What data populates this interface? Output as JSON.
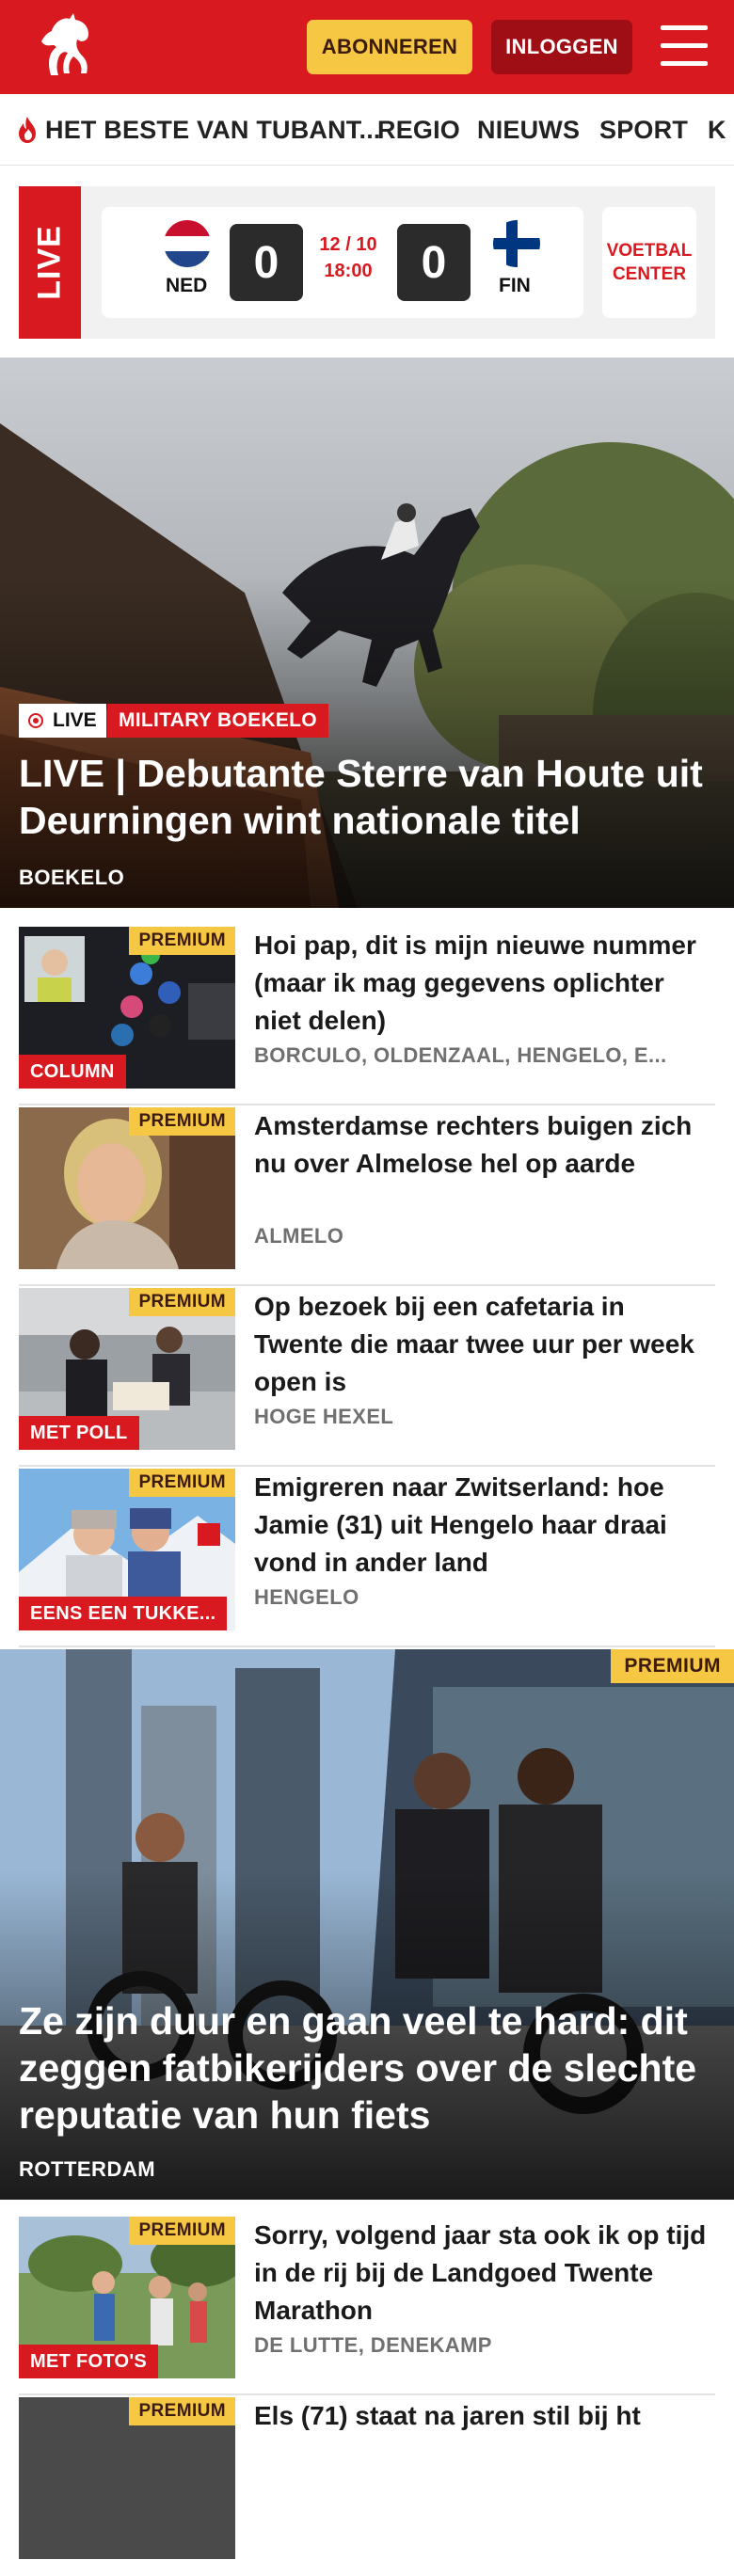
{
  "header": {
    "subscribe_label": "ABONNEREN",
    "login_label": "INLOGGEN",
    "brand_color": "#d81a20"
  },
  "nav": {
    "items": [
      {
        "label": "HET BESTE VAN TUBANT...",
        "icon": "flame-icon"
      },
      {
        "label": "REGIO"
      },
      {
        "label": "NIEUWS"
      },
      {
        "label": "SPORT"
      },
      {
        "label": "K"
      }
    ]
  },
  "live_match": {
    "live_label": "LIVE",
    "home": {
      "code": "NED",
      "score": "0"
    },
    "away": {
      "code": "FIN",
      "score": "0"
    },
    "date": "12 / 10",
    "time": "18:00",
    "center_label_1": "VOETBAL",
    "center_label_2": "CENTER"
  },
  "hero1": {
    "live_tag": "LIVE",
    "category_tag": "MILITARY BOEKELO",
    "title": "LIVE | Debutante Sterre van Houte uit Deurningen wint nationale titel",
    "location": "BOEKELO"
  },
  "articles": [
    {
      "premium": "PREMIUM",
      "label": "COLUMN",
      "title": "Hoi pap, dit is mijn nieuwe nummer (maar ik mag gegevens oplichter niet delen)",
      "location": "BORCULO, OLDENZAAL, HENGELO, E..."
    },
    {
      "premium": "PREMIUM",
      "label": "",
      "title": "Amsterdamse rechters buigen zich nu over Almelose hel op aarde",
      "location": "ALMELO"
    },
    {
      "premium": "PREMIUM",
      "label": "MET POLL",
      "title": "Op bezoek bij een cafetaria in Twente die maar twee uur per week open is",
      "location": "HOGE HEXEL"
    },
    {
      "premium": "PREMIUM",
      "label": "EENS EEN TUKKE...",
      "title": "Emigreren naar Zwitserland: hoe Jamie (31) uit Hengelo haar draai vond in ander land",
      "location": "HENGELO"
    }
  ],
  "hero2": {
    "premium": "PREMIUM",
    "title": "Ze zijn duur en gaan veel te hard: dit zeggen fatbikerijders over de slechte reputatie van hun fiets",
    "location": "ROTTERDAM"
  },
  "articles2": [
    {
      "premium": "PREMIUM",
      "label": "MET FOTO'S",
      "title": "Sorry, volgend jaar sta ook ik op tijd in de rij bij de Landgoed Twente Marathon",
      "location": "DE LUTTE, DENEKAMP"
    },
    {
      "premium": "PREMIUM",
      "label": "",
      "title": "Els (71) staat na jaren stil bij ht",
      "location": ""
    }
  ]
}
